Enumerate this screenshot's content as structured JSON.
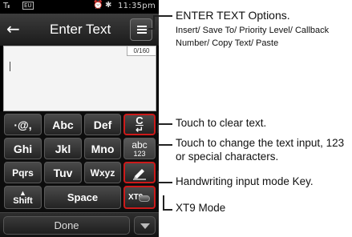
{
  "status_bar": {
    "signal": "Tᵢₗₗ",
    "network": "EU",
    "alarm_icon": "alarm-icon",
    "misc_icon": "bluetooth-icon",
    "time": "11:35pm"
  },
  "title_bar": {
    "back_icon": "back-arrow-icon",
    "title": "Enter Text",
    "options_icon": "menu-list-icon"
  },
  "text_area": {
    "value": "",
    "counter": "0/160"
  },
  "keypad": {
    "rows": [
      [
        "·@,",
        "Abc",
        "Def"
      ],
      [
        "Ghi",
        "Jkl",
        "Mno"
      ],
      [
        "Pqrs",
        "Tuv",
        "Wxyz"
      ]
    ],
    "shift_label": "Shift",
    "space_label": "Space",
    "clear_label": "C",
    "abc_top": "abc",
    "abc_bottom": "123",
    "handwriting_icon": "pen-icon",
    "xt9_label": "XT9"
  },
  "bottom_bar": {
    "done_label": "Done",
    "more_icon": "chevron-down-icon"
  },
  "callouts": {
    "options_title": "ENTER TEXT Options.",
    "options_desc": "Insert/ Save To/ Priority Level/ Callback Number/ Copy Text/ Paste",
    "clear": "Touch to clear text.",
    "change_input": "Touch to change the text input, 123 or special characters.",
    "handwriting": "Handwriting input mode Key.",
    "xt9": "XT9 Mode"
  },
  "colors": {
    "highlight_border": "#cc1a1a",
    "screen_bg": "#000000",
    "key_bg": "#3a3a3a"
  }
}
